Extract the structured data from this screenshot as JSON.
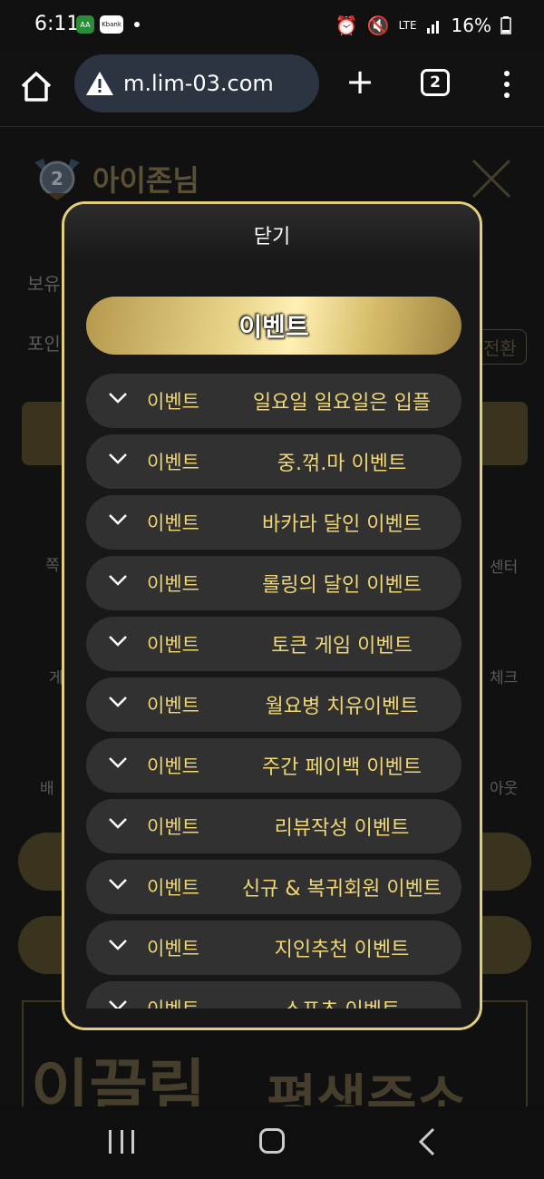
{
  "status_bar": {
    "time": "6:11",
    "left_icons": [
      "AA",
      "Kbank"
    ],
    "network": "LTE",
    "battery": "16%"
  },
  "browser": {
    "url": "m.lim-03.com",
    "tab_count": "2"
  },
  "background": {
    "username": "아이존님",
    "label_1": "보유",
    "label_2": "포인",
    "convert_button": "전환",
    "side_labels": [
      "쪽",
      "센터",
      "게",
      "체크",
      "배",
      "아웃"
    ],
    "banner_left": "이끌림",
    "banner_right": "평생주소"
  },
  "modal": {
    "close_label": "닫기",
    "title": "이벤트",
    "events": [
      {
        "tag": "이벤트",
        "title": "일요일 일요일은 입플"
      },
      {
        "tag": "이벤트",
        "title": "중.꺾.마 이벤트"
      },
      {
        "tag": "이벤트",
        "title": "바카라 달인 이벤트"
      },
      {
        "tag": "이벤트",
        "title": "롤링의 달인 이벤트"
      },
      {
        "tag": "이벤트",
        "title": "토큰 게임 이벤트"
      },
      {
        "tag": "이벤트",
        "title": "월요병 치유이벤트"
      },
      {
        "tag": "이벤트",
        "title": "주간 페이백 이벤트"
      },
      {
        "tag": "이벤트",
        "title": "리뷰작성 이벤트"
      },
      {
        "tag": "이벤트",
        "title": "신규 & 복귀회원 이벤트"
      },
      {
        "tag": "이벤트",
        "title": "지인추천 이벤트"
      },
      {
        "tag": "이벤트",
        "title": "스포츠 이벤트"
      }
    ]
  },
  "colors": {
    "gold_text": "#f0d774",
    "modal_border": "#e3cd7f",
    "item_bg": "#313131"
  }
}
